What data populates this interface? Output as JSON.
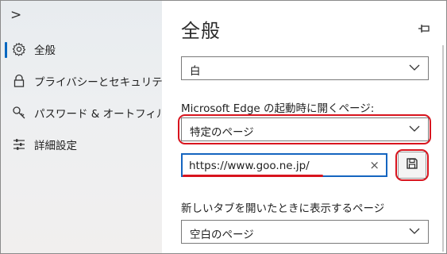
{
  "sidebar": {
    "expand_glyph": ">",
    "items": [
      {
        "label": "全般",
        "icon": "gear-icon",
        "active": true
      },
      {
        "label": "プライバシーとセキュリティ",
        "icon": "lock-icon",
        "active": false
      },
      {
        "label": "パスワード & オートフィル",
        "icon": "key-icon",
        "active": false
      },
      {
        "label": "詳細設定",
        "icon": "sliders-icon",
        "active": false
      }
    ]
  },
  "main": {
    "title": "全般",
    "pin_icon": "pin-icon",
    "theme_dropdown": {
      "value": "白"
    },
    "startup": {
      "label": "Microsoft Edge の起動時に開くページ:",
      "selected": "特定のページ"
    },
    "url_field": {
      "value": "https://www.goo.ne.jp/",
      "clear_glyph": "×"
    },
    "save_button": {
      "icon": "save-icon"
    },
    "newtab": {
      "label": "新しいタブを開いたときに表示するページ",
      "selected": "空白のページ"
    }
  },
  "colors": {
    "accent": "#0067c0",
    "annotation": "#d8141e",
    "field_border": "#1565c0"
  }
}
